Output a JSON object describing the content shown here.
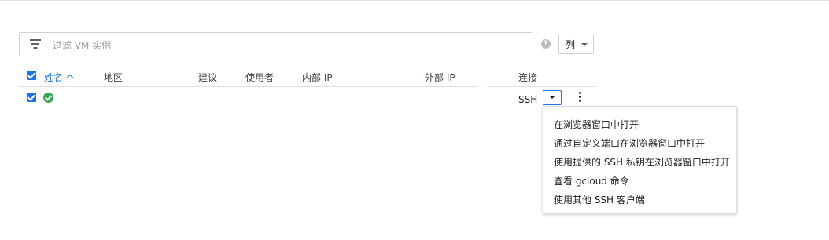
{
  "filter": {
    "placeholder": "过滤 VM 实例",
    "icon": "filter-icon"
  },
  "help": {
    "glyph": "?"
  },
  "columns_button": {
    "label": "列"
  },
  "table": {
    "headers": {
      "name": "姓名",
      "zone": "地区",
      "recommendation": "建议",
      "in_use_by": "使用者",
      "internal_ip": "内部 IP",
      "external_ip": "外部 IP",
      "connect": "连接"
    },
    "rows": [
      {
        "selected": true,
        "status": "ok",
        "connect_label": "SSH"
      }
    ]
  },
  "ssh_menu": {
    "items": [
      "在浏览器窗口中打开",
      "通过自定义端口在浏览器窗口中打开",
      "使用提供的 SSH 私钥在浏览器窗口中打开",
      "查看 gcloud 命令",
      "使用其他 SSH 客户端"
    ]
  },
  "colors": {
    "accent": "#1a73e8",
    "status_ok": "#34a853",
    "border": "#e0e0e0"
  }
}
